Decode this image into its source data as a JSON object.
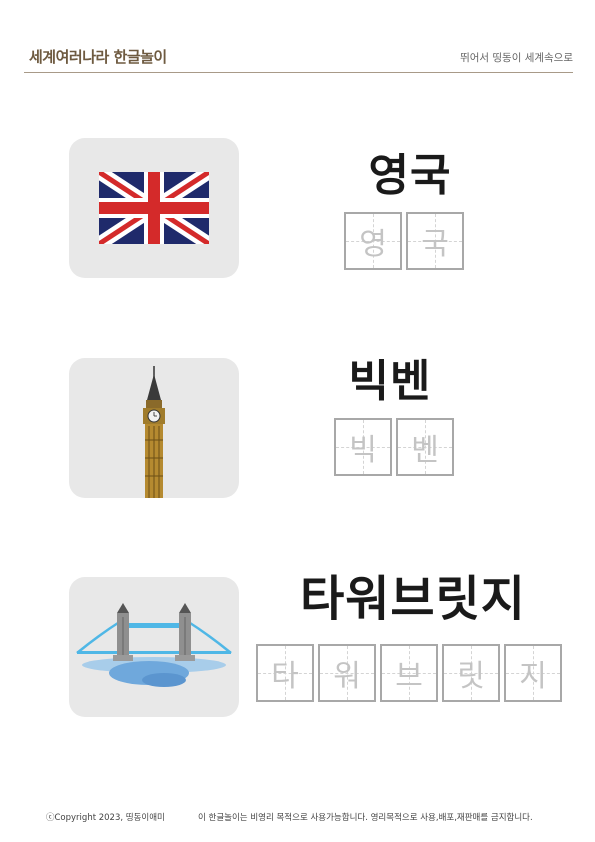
{
  "header": {
    "title": "세계여러나라 한글놀이",
    "subtitle": "뛰어서 띵동이 세계속으로"
  },
  "items": [
    {
      "image": "uk-flag-icon",
      "word": "영국",
      "letters": [
        "영",
        "국"
      ]
    },
    {
      "image": "big-ben-icon",
      "word": "빅벤",
      "letters": [
        "빅",
        "벤"
      ]
    },
    {
      "image": "tower-bridge-icon",
      "word": "타워브릿지",
      "letters": [
        "타",
        "워",
        "브",
        "릿",
        "지"
      ]
    }
  ],
  "footer": {
    "copyright": "ⓒCopyright 2023, 띵동이애미",
    "notice": "이 한글놀이는 비영리 목적으로 사용가능합니다. 영리목적으로 사용,배포,재판매를 금지합니다."
  },
  "colors": {
    "header_title": "#6e5a40",
    "header_line": "#a89a88",
    "card_bg": "#e8e8e8",
    "trace_border": "#a8a8a8",
    "trace_text": "#c4c4c4"
  }
}
